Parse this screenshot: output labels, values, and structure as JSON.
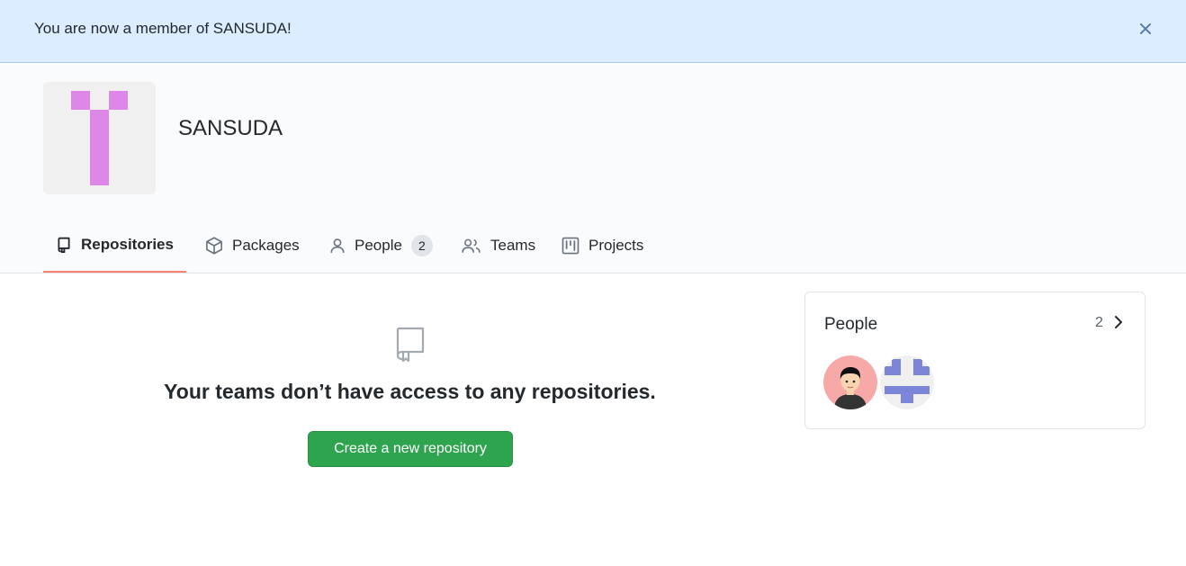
{
  "flash": {
    "message": "You are now a member of SANSUDA!"
  },
  "org": {
    "name": "SANSUDA"
  },
  "tabs": [
    {
      "label": "Repositories",
      "icon": "repo-icon",
      "active": true
    },
    {
      "label": "Packages",
      "icon": "package-icon"
    },
    {
      "label": "People",
      "icon": "person-icon",
      "count": "2"
    },
    {
      "label": "Teams",
      "icon": "people-icon"
    },
    {
      "label": "Projects",
      "icon": "project-icon"
    }
  ],
  "blankslate": {
    "title": "Your teams don’t have access to any repositories.",
    "button_label": "Create a new repository"
  },
  "people": {
    "title": "People",
    "count": "2",
    "members": [
      {
        "icon": "avatar-person-icon"
      },
      {
        "icon": "avatar-identicon-icon"
      }
    ]
  },
  "colors": {
    "flash_bg": "#dbedff",
    "accent_underline": "#f9826c",
    "primary_button": "#2ea44f",
    "org_identicon": "#dd88e8",
    "member_identicon": "#7b86d9"
  }
}
